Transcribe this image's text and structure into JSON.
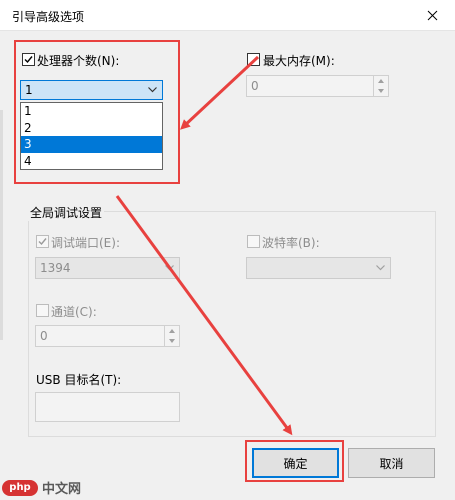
{
  "window": {
    "title": "引导高级选项",
    "close_icon": "close-icon"
  },
  "processors": {
    "label": "处理器个数(N):",
    "checked": true,
    "selected_value": "1",
    "options": [
      "1",
      "2",
      "3",
      "4"
    ],
    "highlighted_option": "3"
  },
  "max_memory": {
    "label": "最大内存(M):",
    "checked": false,
    "value": "0"
  },
  "global_debug": {
    "title": "全局调试设置",
    "debug_port": {
      "label": "调试端口(E):",
      "checked": true,
      "value": "1394"
    },
    "baud_rate": {
      "label": "波特率(B):",
      "checked": false,
      "value": ""
    },
    "channel": {
      "label": "通道(C):",
      "checked": false,
      "value": "0"
    },
    "usb_target": {
      "label": "USB 目标名(T):",
      "value": ""
    }
  },
  "buttons": {
    "ok": "确定",
    "cancel": "取消"
  },
  "watermark": {
    "logo": "php",
    "text": "中文网"
  },
  "colors": {
    "annotation": "#e8413f",
    "accent": "#0078d7"
  }
}
